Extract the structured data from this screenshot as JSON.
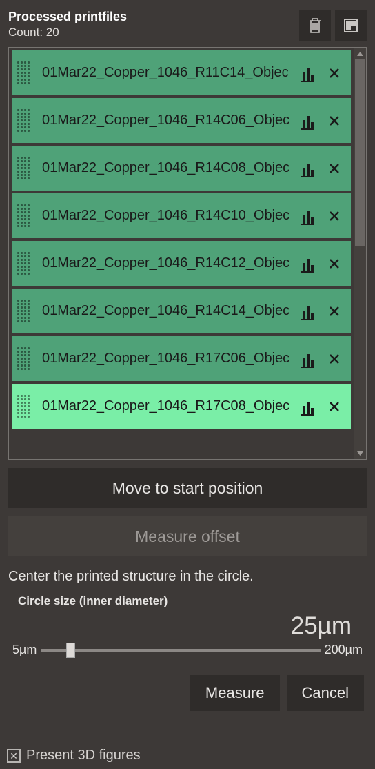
{
  "header": {
    "title": "Processed printfiles",
    "count_label": "Count: 20"
  },
  "list": {
    "items": [
      {
        "label": "01Mar22_Copper_1046_R11C14_Objec",
        "selected": false
      },
      {
        "label": "01Mar22_Copper_1046_R14C06_Objec",
        "selected": false
      },
      {
        "label": "01Mar22_Copper_1046_R14C08_Objec",
        "selected": false
      },
      {
        "label": "01Mar22_Copper_1046_R14C10_Objec",
        "selected": false
      },
      {
        "label": "01Mar22_Copper_1046_R14C12_Objec",
        "selected": false
      },
      {
        "label": "01Mar22_Copper_1046_R14C14_Objec",
        "selected": false
      },
      {
        "label": "01Mar22_Copper_1046_R17C06_Objec",
        "selected": false
      },
      {
        "label": "01Mar22_Copper_1046_R17C08_Objec",
        "selected": true
      }
    ]
  },
  "buttons": {
    "move": "Move to start position",
    "measure_offset": "Measure offset",
    "measure": "Measure",
    "cancel": "Cancel"
  },
  "measure": {
    "instruction": "Center the printed structure in the circle.",
    "size_label": "Circle size (inner diameter)",
    "value_display": "25µm",
    "min_label": "5µm",
    "max_label": "200µm"
  },
  "footer": {
    "checkbox_label": "Present 3D figures",
    "checked": true
  }
}
